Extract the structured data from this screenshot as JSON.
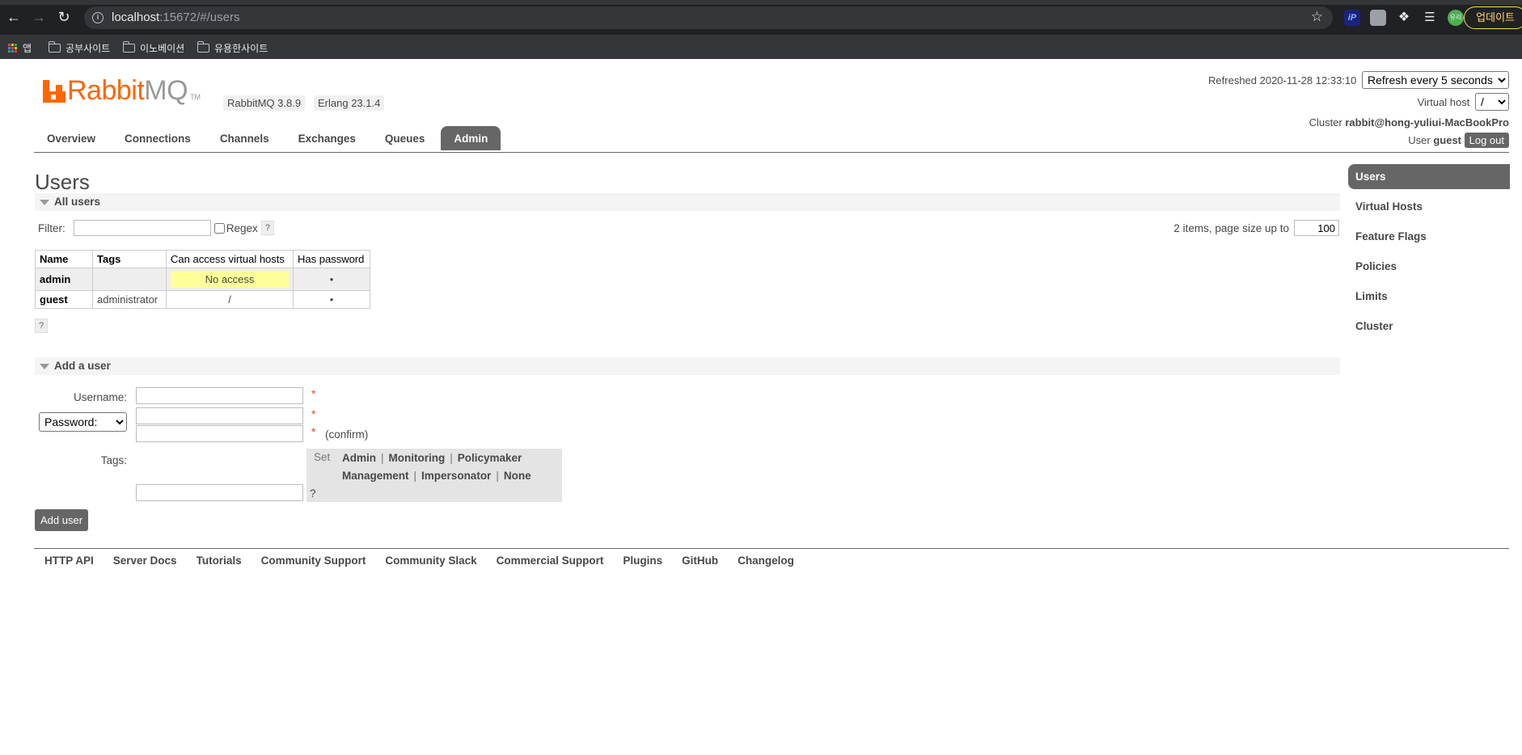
{
  "browser": {
    "url_host": "localhost",
    "url_path": ":15672/#/users",
    "update_label": "업데이트",
    "profile_label": "유리",
    "extension_label": "iP",
    "bookmarks": [
      "앱",
      "공부사이트",
      "이노베이션",
      "유용한사이트"
    ]
  },
  "header": {
    "logo_rabbit": "Rabbit",
    "logo_mq": "MQ",
    "logo_tm": "TM",
    "version": "RabbitMQ 3.8.9",
    "erlang": "Erlang 23.1.4",
    "refreshed_label": "Refreshed 2020-11-28 12:33:10",
    "refresh_option": "Refresh every 5 seconds",
    "vhost_label": "Virtual host",
    "vhost_value": "/",
    "cluster_label": "Cluster",
    "cluster_value": "rabbit@hong-yuliui-MacBookPro",
    "user_label": "User",
    "user_value": "guest",
    "logout": "Log out"
  },
  "tabs": [
    "Overview",
    "Connections",
    "Channels",
    "Exchanges",
    "Queues",
    "Admin"
  ],
  "page_title": "Users",
  "all_users": {
    "section": "All users",
    "filter_label": "Filter:",
    "regex_label": "Regex",
    "help": "?",
    "pager_text": "2 items, page size up to",
    "page_size": "100",
    "columns": [
      "Name",
      "Tags",
      "Can access virtual hosts",
      "Has password"
    ],
    "rows": [
      {
        "name": "admin",
        "tags": "",
        "vhosts": "No access",
        "password": "•"
      },
      {
        "name": "guest",
        "tags": "administrator",
        "vhosts": "/",
        "password": "•"
      }
    ]
  },
  "add_user": {
    "section": "Add a user",
    "username_label": "Username:",
    "password_option": "Password:",
    "confirm": "(confirm)",
    "required": "*",
    "tags_label": "Tags:",
    "set_label": "Set",
    "tag_row1": [
      "Admin",
      "Monitoring",
      "Policymaker"
    ],
    "tag_row2": [
      "Management",
      "Impersonator",
      "None"
    ],
    "sep": "|",
    "help": "?",
    "submit": "Add user"
  },
  "footer": [
    "HTTP API",
    "Server Docs",
    "Tutorials",
    "Community Support",
    "Community Slack",
    "Commercial Support",
    "Plugins",
    "GitHub",
    "Changelog"
  ],
  "sidebar": [
    "Users",
    "Virtual Hosts",
    "Feature Flags",
    "Policies",
    "Limits",
    "Cluster"
  ],
  "colors": {
    "brand": "#ff6600",
    "nav_active": "#666666",
    "no_access_bg": "#ffff99"
  }
}
